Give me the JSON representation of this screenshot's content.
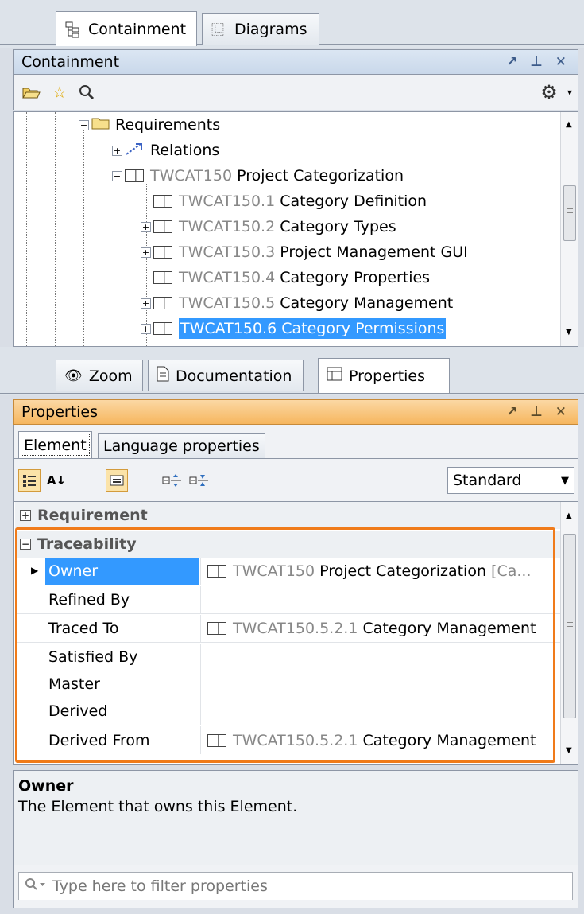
{
  "top_tabs": [
    {
      "label": "Containment",
      "icon": "containment-tree-icon",
      "active": true
    },
    {
      "label": "Diagrams",
      "icon": "diagrams-icon",
      "active": false
    }
  ],
  "containment_panel": {
    "title": "Containment",
    "header_buttons": [
      "↗",
      "⊥",
      "✕"
    ],
    "toolbar": [
      "open-folder-icon",
      "star-icon",
      "search-icon",
      "gear-icon"
    ],
    "tree": [
      {
        "id": "",
        "name": "Requirements",
        "icon": "folder-icon",
        "expander": "−",
        "selected": false
      },
      {
        "id": "",
        "name": "Relations",
        "icon": "relations-icon",
        "expander": "+",
        "selected": false
      },
      {
        "id": "TWCAT150",
        "name": "Project Categorization",
        "icon": "requirement-icon",
        "expander": "−",
        "selected": false
      },
      {
        "id": "TWCAT150.1",
        "name": "Category Definition",
        "icon": "requirement-icon",
        "expander": "",
        "selected": false
      },
      {
        "id": "TWCAT150.2",
        "name": "Category Types",
        "icon": "requirement-icon",
        "expander": "+",
        "selected": false
      },
      {
        "id": "TWCAT150.3",
        "name": "Project Management GUI",
        "icon": "requirement-icon",
        "expander": "+",
        "selected": false
      },
      {
        "id": "TWCAT150.4",
        "name": "Category Properties",
        "icon": "requirement-icon",
        "expander": "",
        "selected": false
      },
      {
        "id": "TWCAT150.5",
        "name": "Category Management",
        "icon": "requirement-icon",
        "expander": "+",
        "selected": false
      },
      {
        "id": "TWCAT150.6",
        "name": "Category Permissions",
        "icon": "requirement-icon",
        "expander": "+",
        "selected": true
      }
    ]
  },
  "bottom_tabs": [
    {
      "label": "Zoom",
      "icon": "zoom-eye-icon"
    },
    {
      "label": "Documentation",
      "icon": "documentation-icon"
    },
    {
      "label": "Properties",
      "icon": "properties-icon"
    }
  ],
  "properties_panel": {
    "title": "Properties",
    "header_buttons": [
      "↗",
      "⊥",
      "✕"
    ],
    "subtabs": [
      "Element",
      "Language properties"
    ],
    "view_select": "Standard",
    "groups": [
      {
        "label": "Requirement",
        "expander": "+"
      },
      {
        "label": "Traceability",
        "expander": "−"
      }
    ],
    "rows": [
      {
        "name": "Owner",
        "value_id": "TWCAT150",
        "value_name": "Project Categorization",
        "value_extra": "[Ca...",
        "selected": true
      },
      {
        "name": "Refined By",
        "value_id": "",
        "value_name": "",
        "value_extra": "",
        "selected": false
      },
      {
        "name": "Traced To",
        "value_id": "TWCAT150.5.2.1",
        "value_name": "Category Management",
        "value_extra": "",
        "selected": false
      },
      {
        "name": "Satisfied By",
        "value_id": "",
        "value_name": "",
        "value_extra": "",
        "selected": false
      },
      {
        "name": "Master",
        "value_id": "",
        "value_name": "",
        "value_extra": "",
        "selected": false
      },
      {
        "name": "Derived",
        "value_id": "",
        "value_name": "",
        "value_extra": "",
        "selected": false
      },
      {
        "name": "Derived From",
        "value_id": "TWCAT150.5.2.1",
        "value_name": "Category Management",
        "value_extra": "",
        "selected": false
      }
    ],
    "description": {
      "title": "Owner",
      "text": "The Element that owns this Element."
    },
    "filter_placeholder": "Type here to filter properties"
  },
  "colors": {
    "selection": "#3399ff",
    "highlight_border": "#f07b1a",
    "panel_header_active": "#f6b65e"
  }
}
